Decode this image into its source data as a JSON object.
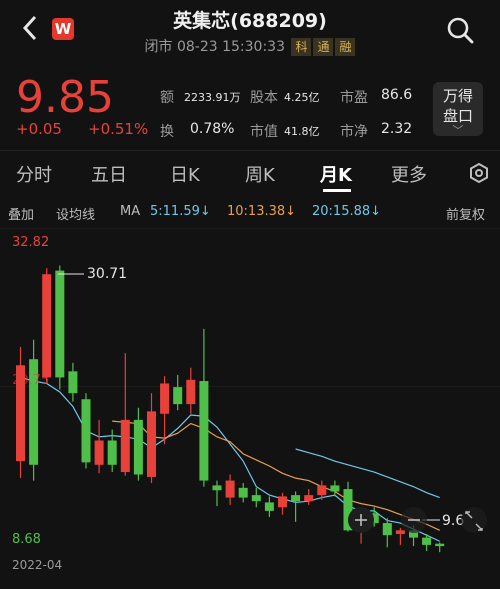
{
  "header": {
    "back_icon": "chevron-left-icon",
    "logo_letter": "W",
    "title": "英集芯(688209)",
    "status": "闭市 08-23 15:30:33",
    "tags": [
      "科",
      "通",
      "融"
    ],
    "search_icon": "search-icon"
  },
  "quote": {
    "price": "9.85",
    "change": "+0.05",
    "change_pct": "+0.51%",
    "stats": [
      {
        "label": "额",
        "value": "2233.91万"
      },
      {
        "label": "股本",
        "value": "4.25亿"
      },
      {
        "label": "市盈",
        "value": "86.6"
      },
      {
        "label": "换",
        "value": "0.78%"
      },
      {
        "label": "市值",
        "value": "41.8亿"
      },
      {
        "label": "市净",
        "value": "2.32"
      }
    ],
    "wande_line1": "万得",
    "wande_line2": "盘口",
    "wande_arrow": "﹀"
  },
  "tabs": [
    "分时",
    "五日",
    "日K",
    "周K",
    "月K",
    "更多"
  ],
  "active_tab": "月K",
  "settings_icon": "gear-icon",
  "indicators": {
    "overlay": "叠加",
    "set_ma": "设均线",
    "ma_label": "MA",
    "ma5": "5:11.59↓",
    "ma10": "10:13.38↓",
    "ma20": "20:15.88↓",
    "adjust": "前复权"
  },
  "colors": {
    "up": "#e8413a",
    "down": "#4ec04a",
    "ma5": "#6fc8e8",
    "ma10": "#e8a050",
    "ma20": "#6fc8e8"
  },
  "chart_data": {
    "type": "candlestick",
    "y_max_label": "32.82",
    "y_mid_label": "20.75",
    "y_min_label": "8.68",
    "high_annotation": "30.71",
    "last_annotation": "9.6",
    "x_start_label": "2022-04",
    "ylim": [
      8.68,
      32.82
    ],
    "candles": [
      {
        "o": 14.6,
        "c": 22.5,
        "h": 24.0,
        "l": 13.2
      },
      {
        "o": 23.0,
        "c": 14.3,
        "h": 24.6,
        "l": 13.0
      },
      {
        "o": 21.5,
        "c": 30.0,
        "h": 30.5,
        "l": 21.0
      },
      {
        "o": 30.3,
        "c": 21.5,
        "h": 30.71,
        "l": 20.5
      },
      {
        "o": 22.0,
        "c": 20.2,
        "h": 22.7,
        "l": 19.5
      },
      {
        "o": 19.7,
        "c": 14.5,
        "h": 20.2,
        "l": 14.0
      },
      {
        "o": 14.3,
        "c": 16.3,
        "h": 18.0,
        "l": 13.6
      },
      {
        "o": 16.3,
        "c": 14.3,
        "h": 17.2,
        "l": 13.7
      },
      {
        "o": 13.7,
        "c": 18.0,
        "h": 23.5,
        "l": 13.4
      },
      {
        "o": 18.0,
        "c": 13.5,
        "h": 19.0,
        "l": 13.0
      },
      {
        "o": 13.3,
        "c": 18.7,
        "h": 20.2,
        "l": 12.8
      },
      {
        "o": 18.5,
        "c": 21.0,
        "h": 21.6,
        "l": 16.0
      },
      {
        "o": 20.7,
        "c": 19.3,
        "h": 21.7,
        "l": 18.8
      },
      {
        "o": 19.3,
        "c": 21.3,
        "h": 22.3,
        "l": 18.5
      },
      {
        "o": 21.2,
        "c": 13.0,
        "h": 25.5,
        "l": 12.5
      },
      {
        "o": 12.6,
        "c": 12.2,
        "h": 13.0,
        "l": 10.9
      },
      {
        "o": 11.6,
        "c": 13.0,
        "h": 13.5,
        "l": 11.0
      },
      {
        "o": 12.4,
        "c": 11.6,
        "h": 12.8,
        "l": 11.2
      },
      {
        "o": 11.8,
        "c": 11.3,
        "h": 12.4,
        "l": 10.8
      },
      {
        "o": 11.2,
        "c": 10.5,
        "h": 11.7,
        "l": 10.0
      },
      {
        "o": 10.8,
        "c": 11.7,
        "h": 12.0,
        "l": 10.2
      },
      {
        "o": 11.8,
        "c": 11.3,
        "h": 12.1,
        "l": 9.6
      },
      {
        "o": 11.3,
        "c": 11.8,
        "h": 12.3,
        "l": 11.0
      },
      {
        "o": 11.8,
        "c": 12.6,
        "h": 13.0,
        "l": 11.4
      },
      {
        "o": 12.6,
        "c": 12.1,
        "h": 13.0,
        "l": 11.7
      },
      {
        "o": 12.3,
        "c": 8.9,
        "h": 12.9,
        "l": 8.8
      },
      {
        "o": 8.9,
        "c": 10.3,
        "h": 10.5,
        "l": 7.8
      },
      {
        "o": 10.3,
        "c": 9.5,
        "h": 10.8,
        "l": 9.2
      },
      {
        "o": 9.5,
        "c": 8.5,
        "h": 9.9,
        "l": 7.5
      },
      {
        "o": 8.6,
        "c": 8.9,
        "h": 9.1,
        "l": 7.7
      },
      {
        "o": 8.9,
        "c": 8.3,
        "h": 9.3,
        "l": 7.6
      },
      {
        "o": 8.3,
        "c": 7.7,
        "h": 8.6,
        "l": 7.2
      },
      {
        "o": 7.8,
        "c": 7.6,
        "h": 7.9,
        "l": 7.1
      }
    ],
    "ma5_line": [
      21.5,
      21.2,
      21.0,
      20.3,
      19.1,
      17.1,
      16.6,
      16.7,
      16.6,
      16.4,
      15.7,
      16.4,
      17.3,
      18.4,
      18.3,
      17.4,
      16.0,
      14.6,
      12.5,
      11.8,
      11.5,
      11.2,
      11.3,
      11.6,
      11.8,
      10.9,
      10.5,
      10.5,
      9.7,
      9.5,
      9.0,
      8.5,
      8.0
    ],
    "ma10_line": [
      null,
      null,
      null,
      null,
      null,
      null,
      null,
      17.9,
      17.8,
      17.7,
      16.6,
      16.5,
      16.9,
      17.7,
      17.3,
      16.6,
      16.2,
      15.2,
      14.7,
      14.2,
      13.6,
      13.2,
      13.0,
      12.5,
      12.1,
      11.4,
      11.1,
      10.9,
      10.6,
      10.2,
      9.8,
      9.4,
      8.9
    ],
    "ma20_line": [
      null,
      null,
      null,
      null,
      null,
      null,
      null,
      null,
      null,
      null,
      null,
      null,
      null,
      null,
      null,
      null,
      null,
      null,
      null,
      null,
      null,
      15.6,
      15.3,
      15.0,
      14.6,
      14.3,
      14.0,
      13.7,
      13.3,
      12.9,
      12.5,
      12.0,
      11.6
    ]
  },
  "controls": {
    "zoom_in_icon": "plus-icon",
    "zoom_out_icon": "minus-icon",
    "expand_icon": "expand-icon"
  }
}
